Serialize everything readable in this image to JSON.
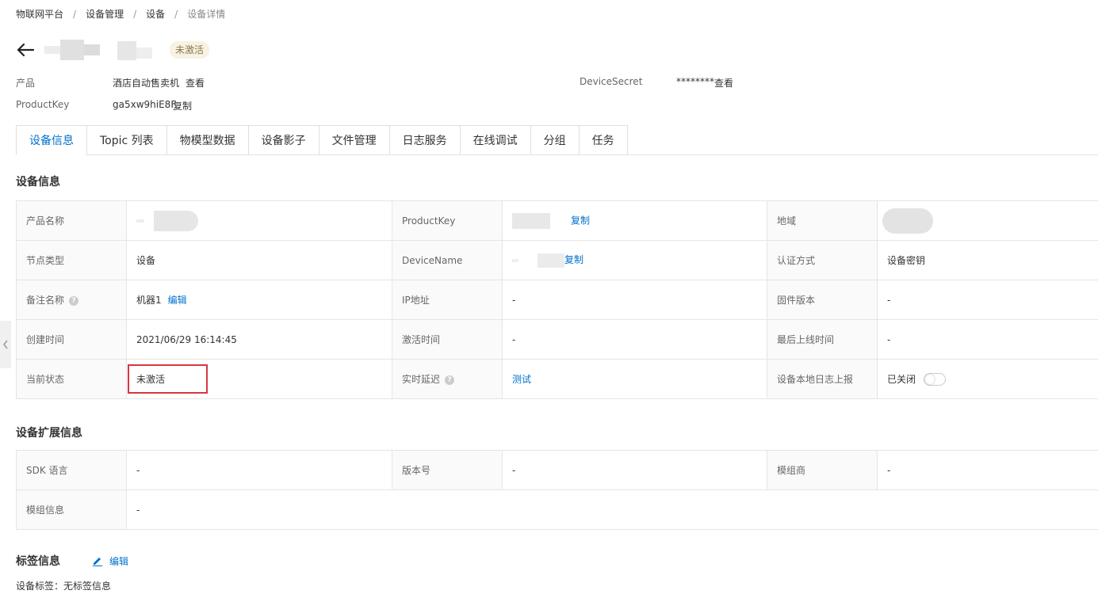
{
  "breadcrumb": [
    "物联网平台",
    "设备管理",
    "设备",
    "设备详情"
  ],
  "header": {
    "status_tag": "未激活"
  },
  "meta": {
    "product_label": "产品",
    "product_value": "酒店自动售卖机",
    "product_link": "查看",
    "productkey_label": "ProductKey",
    "productkey_value": "ga5xw9hiE8F",
    "productkey_copy": "复制",
    "secret_label": "DeviceSecret",
    "secret_value": "********",
    "secret_link": "查看"
  },
  "tabs": [
    "设备信息",
    "Topic 列表",
    "物模型数据",
    "设备影子",
    "文件管理",
    "日志服务",
    "在线调试",
    "分组",
    "任务"
  ],
  "device_info": {
    "title": "设备信息",
    "product_name_label": "产品名称",
    "productkey_label": "ProductKey",
    "productkey_copy": "复制",
    "region_label": "地域",
    "node_type_label": "节点类型",
    "node_type_value": "设备",
    "devicename_label": "DeviceName",
    "devicename_copy": "复制",
    "auth_label": "认证方式",
    "auth_value": "设备密钥",
    "remark_label": "备注名称",
    "remark_value": "机器1",
    "remark_edit": "编辑",
    "ip_label": "IP地址",
    "ip_value": "-",
    "firmware_label": "固件版本",
    "firmware_value": "-",
    "created_label": "创建时间",
    "created_value": "2021/06/29 16:14:45",
    "activated_label": "激活时间",
    "activated_value": "-",
    "last_online_label": "最后上线时间",
    "last_online_value": "-",
    "status_label": "当前状态",
    "status_value": "未激活",
    "latency_label": "实时延迟",
    "latency_link": "测试",
    "local_log_label": "设备本地日志上报",
    "local_log_value": "已关闭"
  },
  "ext_info": {
    "title": "设备扩展信息",
    "sdk_label": "SDK 语言",
    "sdk_value": "-",
    "version_label": "版本号",
    "version_value": "-",
    "module_vendor_label": "模组商",
    "module_vendor_value": "-",
    "module_info_label": "模组信息",
    "module_info_value": "-"
  },
  "tags": {
    "title": "标签信息",
    "edit": "编辑",
    "device_tags_label": "设备标签：",
    "device_tags_value": "无标签信息"
  },
  "colors": {
    "link": "#0070cc",
    "highlight": "#d9363e",
    "status_tag_bg": "#f7f2e3"
  }
}
